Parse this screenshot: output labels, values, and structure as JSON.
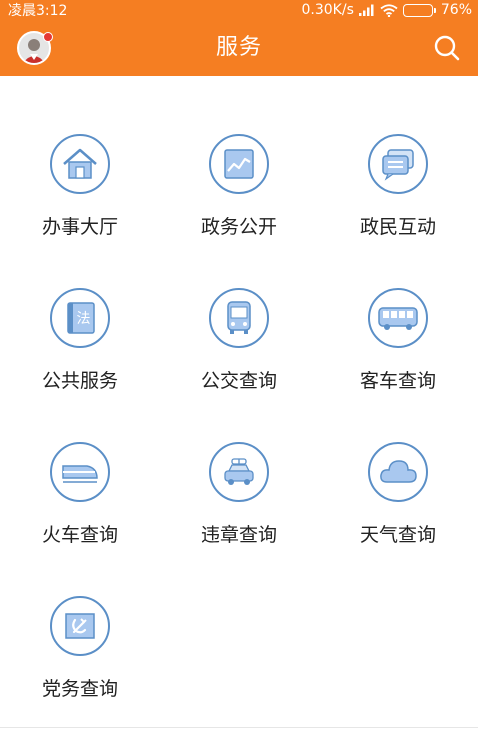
{
  "status": {
    "time": "凌晨3:12",
    "speed": "0.30K/s",
    "battery": "76%",
    "battery_level": 0.76
  },
  "header": {
    "title": "服务"
  },
  "services": [
    {
      "label": "办事大厅",
      "icon": "house-icon"
    },
    {
      "label": "政务公开",
      "icon": "chart-icon"
    },
    {
      "label": "政民互动",
      "icon": "chat-icon"
    },
    {
      "label": "公共服务",
      "icon": "law-book-icon"
    },
    {
      "label": "公交查询",
      "icon": "bus-front-icon"
    },
    {
      "label": "客车查询",
      "icon": "coach-icon"
    },
    {
      "label": "火车查询",
      "icon": "train-icon"
    },
    {
      "label": "违章查询",
      "icon": "police-car-icon"
    },
    {
      "label": "天气查询",
      "icon": "cloud-icon"
    },
    {
      "label": "党务查询",
      "icon": "party-flag-icon"
    }
  ],
  "colors": {
    "header": "#f57e22",
    "icon_border": "#5b8fc7",
    "icon_fill": "#a9c8ef"
  }
}
